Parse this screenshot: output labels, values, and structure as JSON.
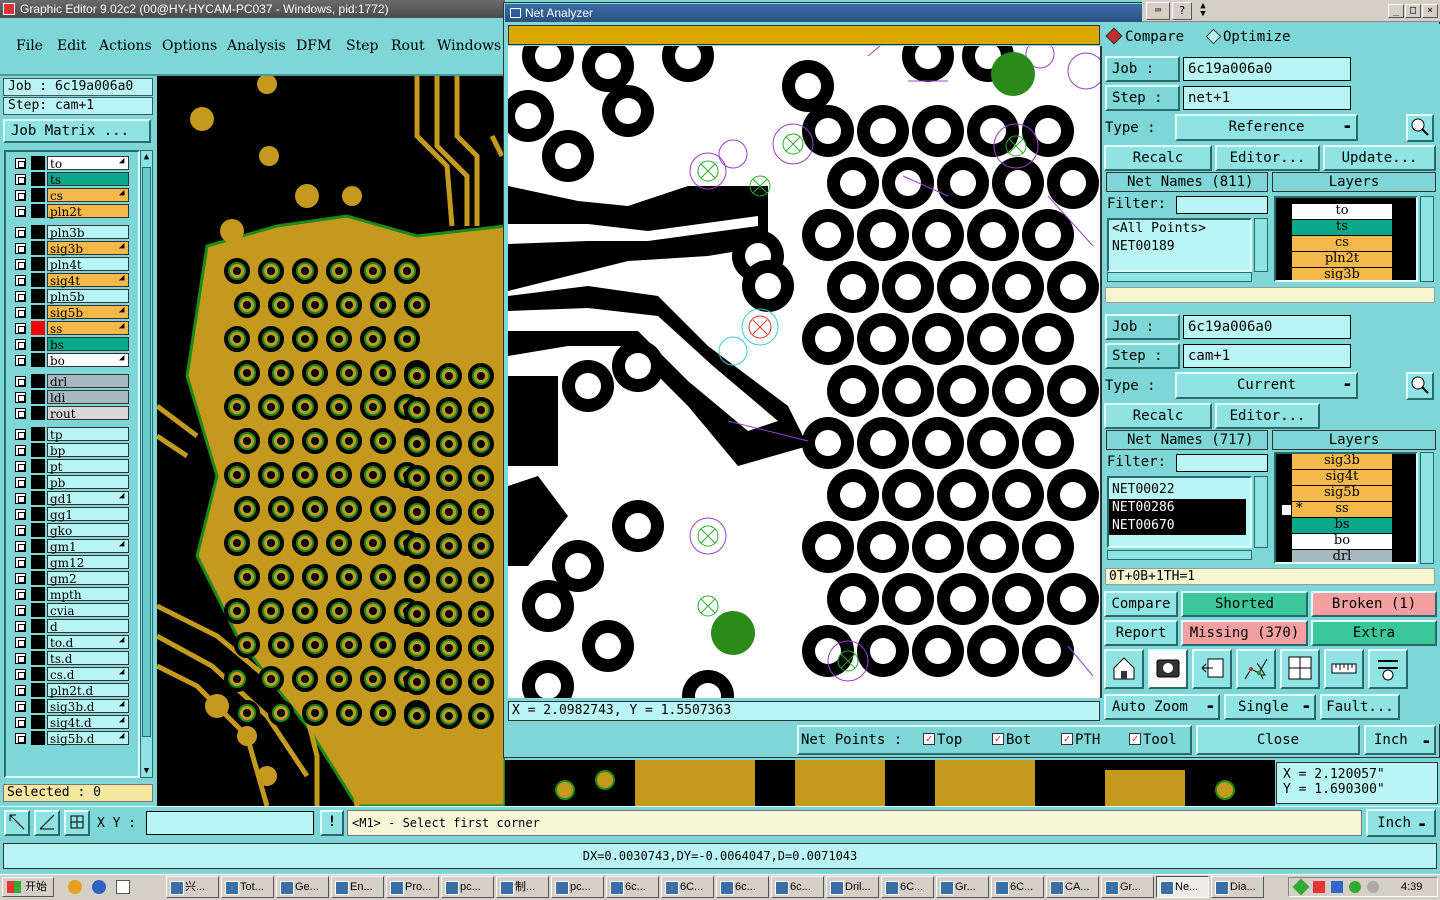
{
  "main_window": {
    "title": "Graphic Editor 9.02c2 (00@HY-HYCAM-PC037 - Windows, pid:1772)",
    "menu": [
      "File",
      "Edit",
      "Actions",
      "Options",
      "Analysis",
      "DFM",
      "Step",
      "Rout",
      "Windows"
    ],
    "job": "Job : 6c19a006a0",
    "step": "Step: cam+1",
    "job_matrix": "Job Matrix ...",
    "layers": [
      {
        "name": "to",
        "color": "#ffffff",
        "arrow": true
      },
      {
        "name": "ts",
        "color": "#0aa88a",
        "arrow": false
      },
      {
        "name": "cs",
        "color": "#f5b84a",
        "arrow": true
      },
      {
        "name": "pln2t",
        "color": "#f5b84a",
        "arrow": false
      },
      {
        "name": "pln3b",
        "color": "#b9f5f5",
        "arrow": false
      },
      {
        "name": "sig3b",
        "color": "#f5b84a",
        "arrow": true
      },
      {
        "name": "pln4t",
        "color": "#b9f5f5",
        "arrow": false
      },
      {
        "name": "sig4t",
        "color": "#f5b84a",
        "arrow": true
      },
      {
        "name": "pln5b",
        "color": "#b9f5f5",
        "arrow": false
      },
      {
        "name": "sig5b",
        "color": "#f5b84a",
        "arrow": true
      },
      {
        "name": "ss",
        "color": "#f5b84a",
        "arrow": true,
        "active": true
      },
      {
        "name": "bs",
        "color": "#0aa88a",
        "arrow": false
      },
      {
        "name": "bo",
        "color": "#ffffff",
        "arrow": true
      },
      {
        "name": "drl",
        "color": "#a6b8c0",
        "arrow": false
      },
      {
        "name": "ldi",
        "color": "#a6b8c0",
        "arrow": false
      },
      {
        "name": "rout",
        "color": "#d8d8d8",
        "arrow": false
      },
      {
        "name": "tp",
        "color": "#b9f5f5",
        "arrow": false
      },
      {
        "name": "bp",
        "color": "#b9f5f5",
        "arrow": false
      },
      {
        "name": "pt",
        "color": "#b9f5f5",
        "arrow": false
      },
      {
        "name": "pb",
        "color": "#b9f5f5",
        "arrow": false
      },
      {
        "name": "gd1",
        "color": "#b9f5f5",
        "arrow": true
      },
      {
        "name": "gg1",
        "color": "#b9f5f5",
        "arrow": false
      },
      {
        "name": "gko",
        "color": "#b9f5f5",
        "arrow": false
      },
      {
        "name": "gm1",
        "color": "#b9f5f5",
        "arrow": true
      },
      {
        "name": "gm12",
        "color": "#b9f5f5",
        "arrow": false
      },
      {
        "name": "gm2",
        "color": "#b9f5f5",
        "arrow": false
      },
      {
        "name": "mpth",
        "color": "#b9f5f5",
        "arrow": false
      },
      {
        "name": "cvia",
        "color": "#b9f5f5",
        "arrow": false
      },
      {
        "name": "d",
        "color": "#b9f5f5",
        "arrow": false
      },
      {
        "name": "to.d",
        "color": "#b9f5f5",
        "arrow": true
      },
      {
        "name": "ts.d",
        "color": "#b9f5f5",
        "arrow": false
      },
      {
        "name": "cs.d",
        "color": "#b9f5f5",
        "arrow": true
      },
      {
        "name": "pln2t.d",
        "color": "#b9f5f5",
        "arrow": false
      },
      {
        "name": "sig3b.d",
        "color": "#b9f5f5",
        "arrow": true
      },
      {
        "name": "sig4t.d",
        "color": "#b9f5f5",
        "arrow": true
      },
      {
        "name": "sig5b.d",
        "color": "#b9f5f5",
        "arrow": true
      }
    ],
    "selected": "Selected : 0",
    "xy_label": "X Y :",
    "prompt": "<M1> - Select first corner",
    "units": "Inch",
    "coords_x": "X = 2.120057\"",
    "coords_y": "Y = 1.690300\"",
    "status_line": "DX=0.0030743,DY=-0.0064047,D=0.0071043"
  },
  "net_analyzer": {
    "title": "Net Analyzer",
    "coord_readout": "X = 2.0982743, Y = 1.5507363",
    "mode_compare": "Compare",
    "mode_optimize": "Optimize",
    "ref": {
      "job_label": "Job :",
      "job": "6c19a006a0",
      "step_label": "Step :",
      "step": "net+1",
      "type_label": "Type :",
      "type": "Reference",
      "recalc": "Recalc",
      "editor": "Editor...",
      "update": "Update...",
      "net_names": "Net Names (811)",
      "layers_label": "Layers",
      "filter": "Filter:",
      "nets": [
        "<All Points>",
        "NET00189"
      ],
      "layers": [
        {
          "name": "to",
          "color": "#ffffff"
        },
        {
          "name": "ts",
          "color": "#0aa88a"
        },
        {
          "name": "cs",
          "color": "#f5b84a"
        },
        {
          "name": "pln2t",
          "color": "#f5b84a"
        },
        {
          "name": "sig3b",
          "color": "#f5b84a"
        }
      ]
    },
    "cur": {
      "job_label": "Job :",
      "job": "6c19a006a0",
      "step_label": "Step :",
      "step": "cam+1",
      "type_label": "Type :",
      "type": "Current",
      "recalc": "Recalc",
      "editor": "Editor...",
      "net_names": "Net Names (717)",
      "layers_label": "Layers",
      "filter": "Filter:",
      "nets": [
        "NET00022",
        "NET00286",
        "NET00670"
      ],
      "layers": [
        {
          "name": "sig3b",
          "color": "#f5b84a",
          "star": ""
        },
        {
          "name": "sig4t",
          "color": "#f5b84a",
          "star": ""
        },
        {
          "name": "sig5b",
          "color": "#f5b84a",
          "star": ""
        },
        {
          "name": "ss",
          "color": "#f5b84a",
          "star": "*"
        },
        {
          "name": "bs",
          "color": "#0aa88a",
          "star": ""
        },
        {
          "name": "bo",
          "color": "#ffffff",
          "star": ""
        },
        {
          "name": "drl",
          "color": "#a6b8c0",
          "star": ""
        }
      ],
      "summary": "0T+0B+1TH=1"
    },
    "results": {
      "compare": "Compare",
      "shorted": "Shorted",
      "broken": "Broken (1)",
      "report": "Report",
      "missing": "Missing (370)",
      "extra": "Extra"
    },
    "auto_zoom": "Auto Zoom",
    "single": "Single",
    "fault": "Fault...",
    "net_points_label": "Net Points :",
    "checks": [
      "Top",
      "Bot",
      "PTH",
      "Tool"
    ],
    "close": "Close",
    "units": "Inch"
  },
  "taskbar": {
    "start": "开始",
    "items": [
      "兴...",
      "Tot...",
      "Ge...",
      "En...",
      "Pro...",
      "pc...",
      "制...",
      "pc...",
      "6c...",
      "6C...",
      "6c...",
      "6c...",
      "Dril...",
      "6C...",
      "Gr...",
      "6C...",
      "CA...",
      "Gr...",
      "Ne...",
      "Dia..."
    ],
    "clock": "4:39"
  }
}
